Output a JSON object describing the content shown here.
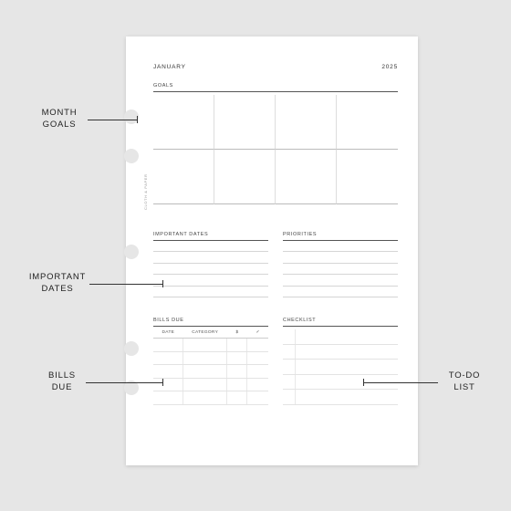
{
  "header": {
    "month": "JANUARY",
    "year": "2025"
  },
  "sections": {
    "goals": "GOALS",
    "important_dates": "IMPORTANT DATES",
    "priorities": "PRIORITIES",
    "bills_due": "BILLS DUE",
    "checklist": "CHECKLIST"
  },
  "bills_header": {
    "date": "DATE",
    "category": "CATEGORY",
    "amount": "$",
    "check": "✓"
  },
  "side_brand": "CLOTH & PAPER",
  "callouts": {
    "goals": "MONTH\nGOALS",
    "important_dates": "IMPORTANT\nDATES",
    "bills": "BILLS\nDUE",
    "todo": "TO-DO\nLIST"
  }
}
